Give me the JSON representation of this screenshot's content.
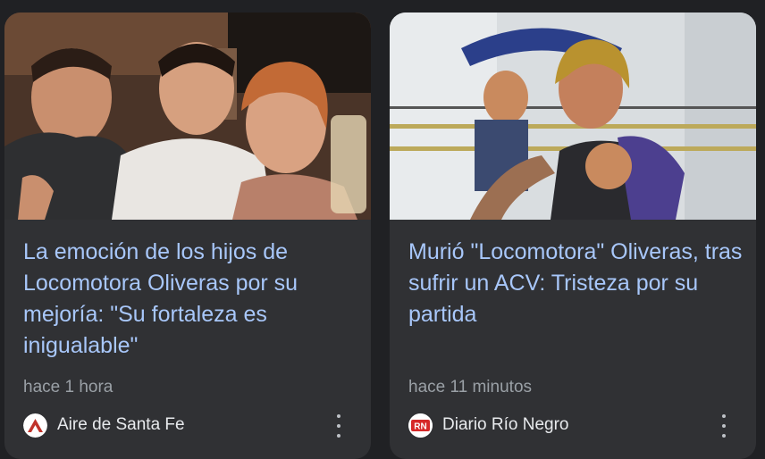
{
  "cards": [
    {
      "headline": "La emoción de los hijos de Locomotora Oliveras por su mejoría: \"Su fortaleza es inigualable\"",
      "time": "hace 1 hora",
      "source": "Aire de Santa Fe",
      "image": "photo-family-group",
      "logo_icon": "aire-de-santa-fe-logo-icon",
      "more_icon": "more-vert-icon"
    },
    {
      "headline": "Murió \"Locomotora\" Oliveras, tras sufrir un ACV: Tristeza por su partida",
      "time": "hace 11 minutos",
      "source": "Diario Río Negro",
      "logo_text": "RN",
      "image": "photo-boxer-punch",
      "logo_icon": "diario-rio-negro-logo-icon",
      "more_icon": "more-vert-icon"
    }
  ],
  "colors": {
    "background": "#202124",
    "card": "#303134",
    "headline": "#a8c7fa",
    "meta": "#9aa0a6",
    "source": "#e8eaed"
  }
}
